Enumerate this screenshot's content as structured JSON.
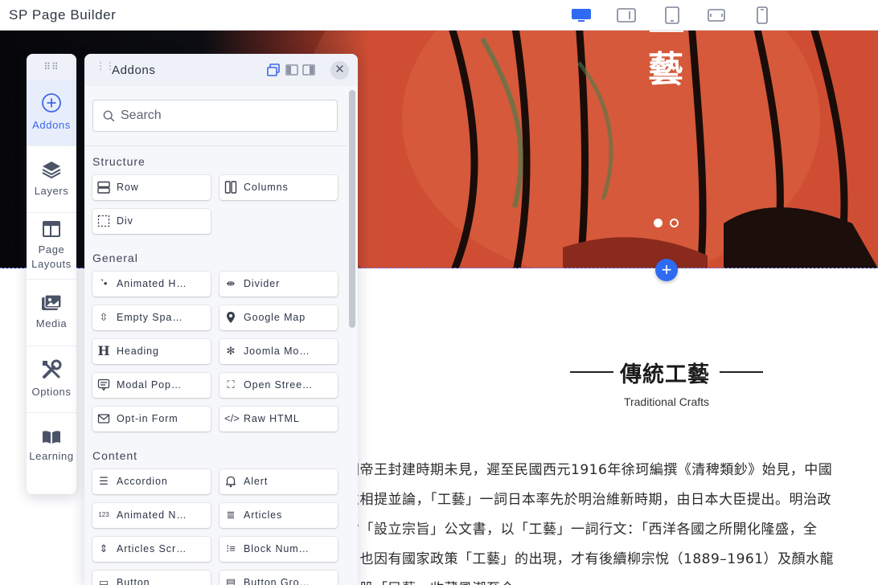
{
  "app": {
    "title": "SP Page Builder"
  },
  "devices": [
    {
      "name": "desktop-device-icon",
      "active": true
    },
    {
      "name": "laptop-device-icon",
      "active": false
    },
    {
      "name": "tablet-device-icon",
      "active": false
    },
    {
      "name": "tablet-landscape-device-icon",
      "active": false
    },
    {
      "name": "mobile-device-icon",
      "active": false
    }
  ],
  "colors": {
    "accent": "#3b67e8",
    "add_button": "#2f6bf2",
    "hero": "#c7452e"
  },
  "rail": {
    "items": [
      {
        "label": "Addons",
        "icon": "plus-circle-icon",
        "active": true
      },
      {
        "label": "Layers",
        "icon": "layers-icon"
      },
      {
        "label": "Page Layouts",
        "icon": "page-layouts-icon"
      },
      {
        "label": "Media",
        "icon": "media-icon"
      },
      {
        "label": "Options",
        "icon": "tools-icon"
      },
      {
        "label": "Learning",
        "icon": "book-icon"
      }
    ]
  },
  "panel": {
    "title": "Addons",
    "search_placeholder": "Search",
    "close": "✕",
    "groups": [
      {
        "title": "Structure",
        "items": [
          {
            "label": "Row",
            "icon": "row-icon"
          },
          {
            "label": "Columns",
            "icon": "columns-icon"
          },
          {
            "label": "Div",
            "icon": "div-icon"
          }
        ]
      },
      {
        "title": "General",
        "items": [
          {
            "label": "Animated H…",
            "icon": "animated-heading-icon"
          },
          {
            "label": "Divider",
            "icon": "divider-icon"
          },
          {
            "label": "Empty Spa…",
            "icon": "empty-space-icon"
          },
          {
            "label": "Google Map",
            "icon": "map-pin-icon"
          },
          {
            "label": "Heading",
            "icon": "heading-icon"
          },
          {
            "label": "Joomla Mo…",
            "icon": "joomla-icon"
          },
          {
            "label": "Modal Pop…",
            "icon": "modal-icon"
          },
          {
            "label": "Open Stree…",
            "icon": "open-street-map-icon"
          },
          {
            "label": "Opt-in Form",
            "icon": "envelope-icon"
          },
          {
            "label": "Raw HTML",
            "icon": "code-icon"
          }
        ]
      },
      {
        "title": "Content",
        "items": [
          {
            "label": "Accordion",
            "icon": "accordion-icon"
          },
          {
            "label": "Alert",
            "icon": "bell-icon"
          },
          {
            "label": "Animated N…",
            "icon": "animated-number-icon"
          },
          {
            "label": "Articles",
            "icon": "articles-icon"
          },
          {
            "label": "Articles Scr…",
            "icon": "articles-scroller-icon"
          },
          {
            "label": "Block Num…",
            "icon": "block-number-icon"
          },
          {
            "label": "Button",
            "icon": "button-icon"
          },
          {
            "label": "Button Gro…",
            "icon": "button-group-icon"
          }
        ]
      }
    ]
  },
  "canvas": {
    "hero_title": "藝",
    "slider_dots": 2,
    "section_heading": "傳統工藝",
    "section_subheading": "Traditional Crafts",
    "paragraph_lines": [
      "國帝王封建時期未見，遲至民國西元1916年徐珂編撰《清稗類鈔》始見，中國",
      "並相提並論，「工藝」一詞日本率先於明治維新時期，由日本大臣提出。明治政",
      "省「設立宗旨」公文書，以「工藝」一詞行文：「西洋各國之所開化隆盛，全",
      "，也因有國家政策「工藝」的出現，才有後續柳宗悅（1889–1961）及顏水龍",
      "一股「民藝」收藏風潮至今。"
    ]
  }
}
